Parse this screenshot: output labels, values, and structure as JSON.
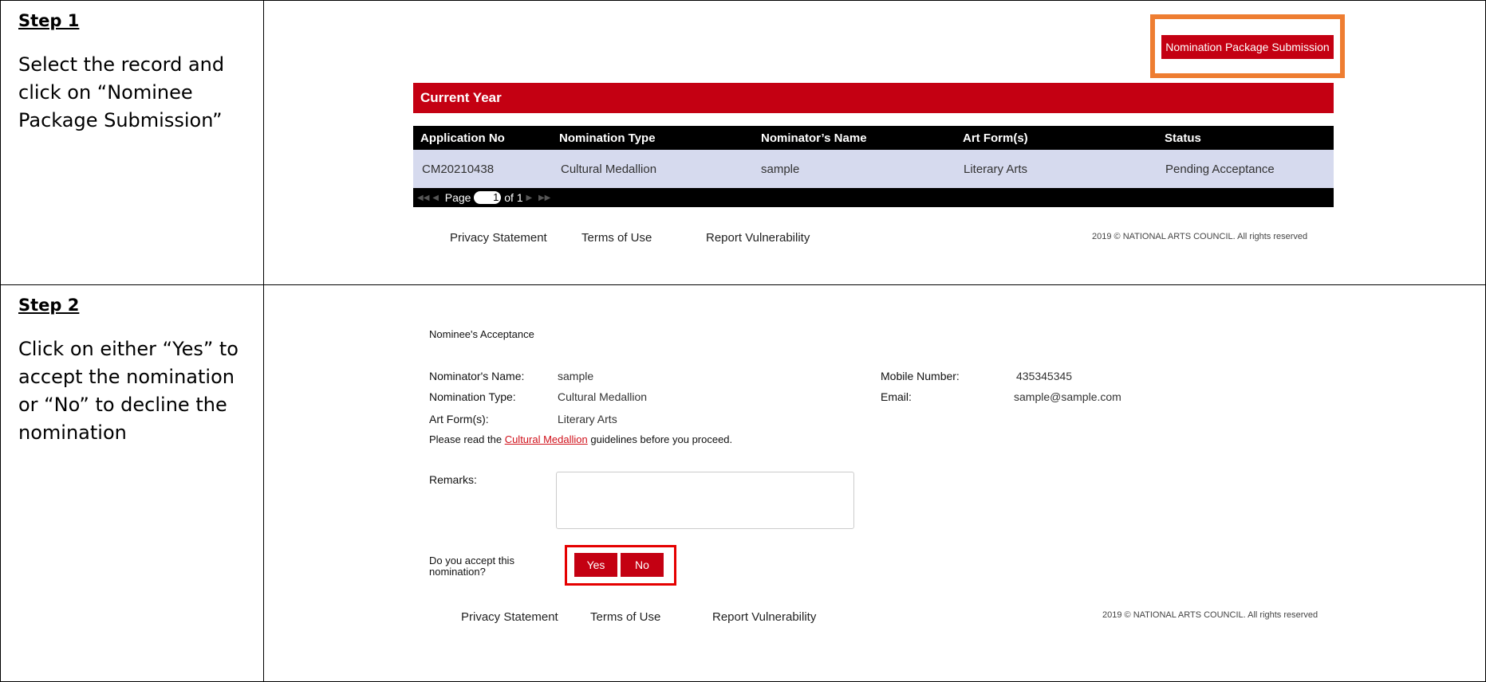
{
  "steps": [
    {
      "title": "Step 1",
      "instruction": "Select the record and\nclick on “Nominee\nPackage Submission”"
    },
    {
      "title": "Step 2",
      "instruction": "Click on either “Yes” to\naccept the nomination\nor “No” to decline the\nnomination"
    }
  ],
  "step1": {
    "submit_button": "Nomination Package Submission",
    "section_title": "Current Year",
    "columns": [
      "Application No",
      "Nomination Type",
      "Nominator’s Name",
      "Art Form(s)",
      "Status"
    ],
    "row": [
      "CM20210438",
      "Cultural Medallion",
      "sample",
      "Literary Arts",
      "Pending Acceptance"
    ],
    "pager": {
      "page_label": "Page",
      "page_value": "1",
      "of_label": "of 1"
    }
  },
  "footer": {
    "links": [
      "Privacy Statement",
      "Terms of Use",
      "Report Vulnerability"
    ],
    "copyright": "2019 © NATIONAL ARTS COUNCIL. All rights reserved"
  },
  "step2": {
    "heading": "Nominee's Acceptance",
    "nominator_label": "Nominator's Name:",
    "nominator_value": "sample",
    "type_label": "Nomination Type:",
    "type_value": "Cultural Medallion",
    "art_label": "Art Form(s):",
    "art_value": "Literary Arts",
    "mobile_label": "Mobile Number:",
    "mobile_value": "435345345",
    "email_label": "Email:",
    "email_value": "sample@sample.com",
    "guidelines_prefix": "Please read the ",
    "guidelines_link": "Cultural Medallion",
    "guidelines_suffix": " guidelines before you proceed.",
    "remarks_label": "Remarks:",
    "remarks_value": "",
    "accept_question": "Do you accept this\nnomination?",
    "yes_label": "Yes",
    "no_label": "No"
  },
  "colors": {
    "accent_red": "#c40012",
    "highlight_orange": "#ee7d31",
    "highlight_red": "#e50000",
    "row_bg": "#d6daee"
  }
}
